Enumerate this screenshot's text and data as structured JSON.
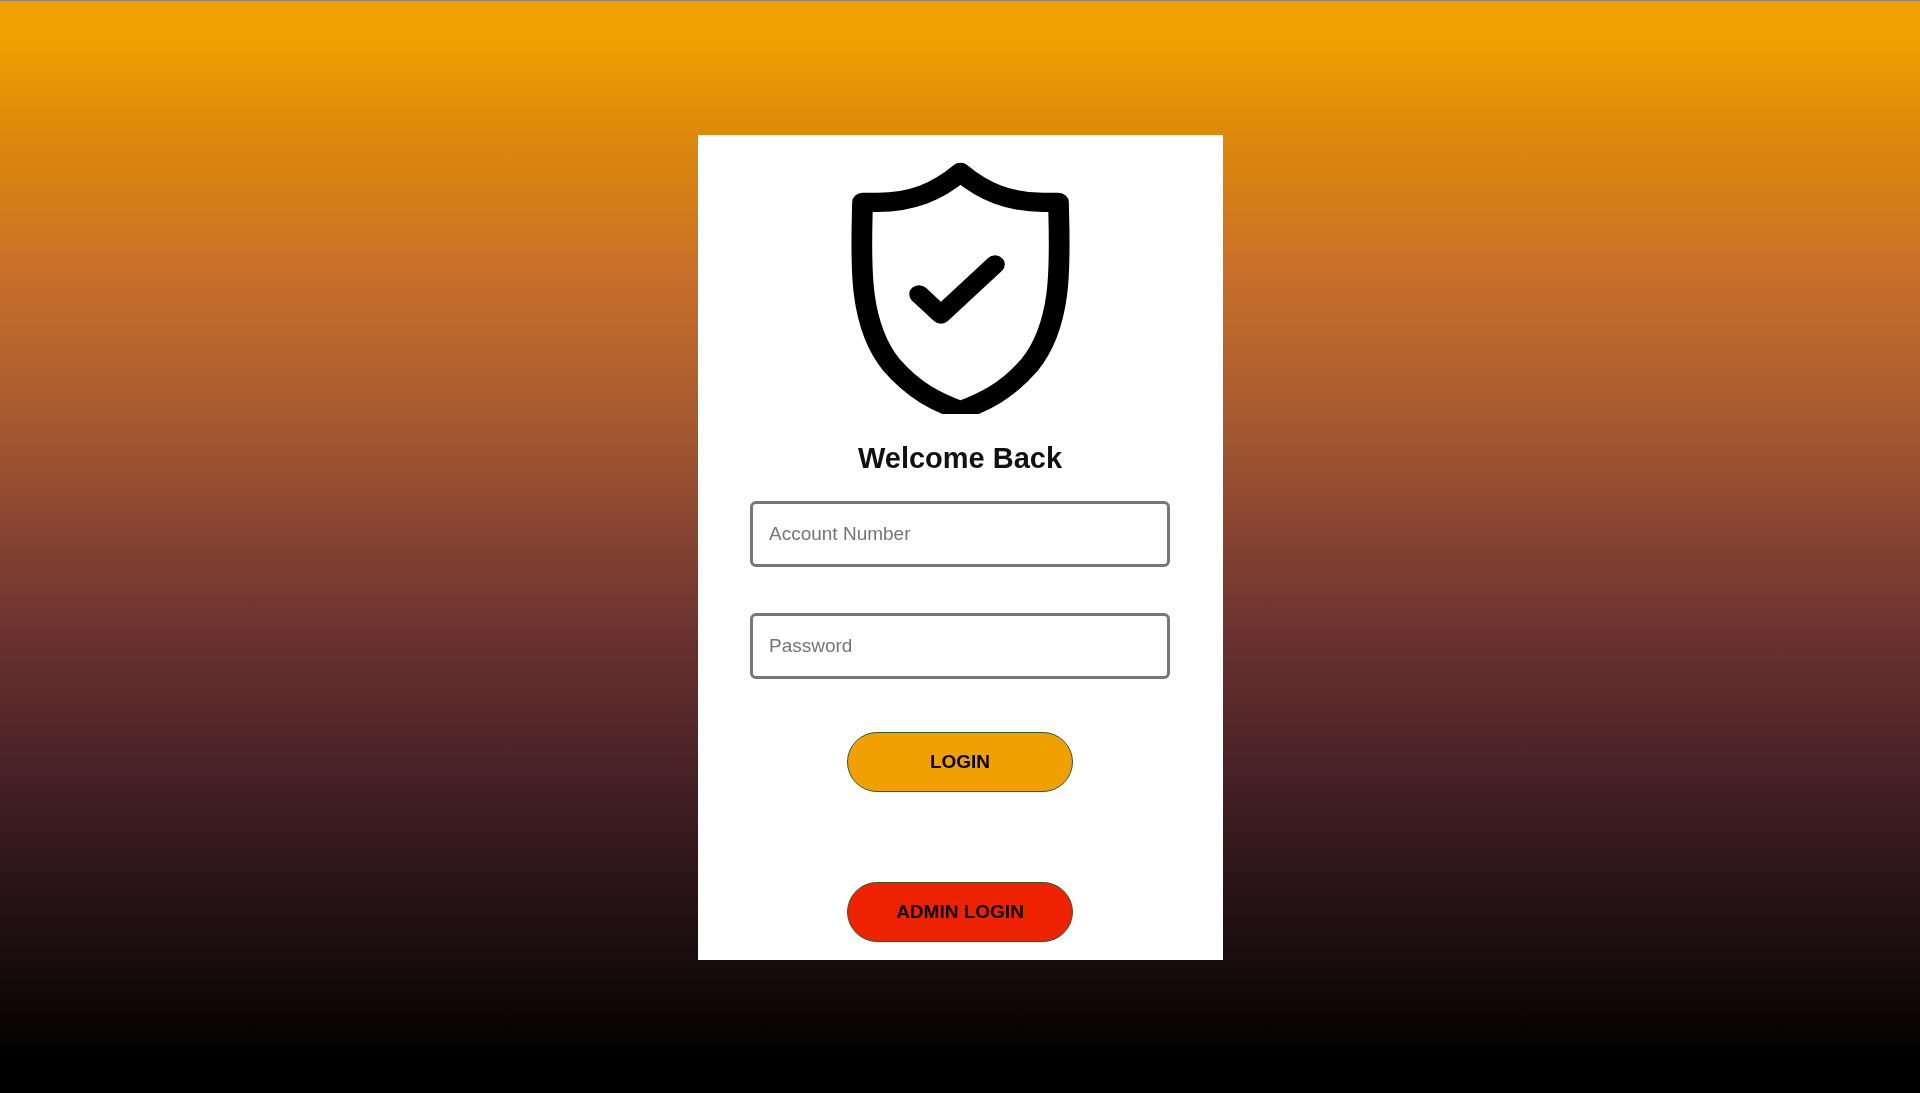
{
  "title": "Welcome Back",
  "fields": [
    {
      "placeholder": "Account Number"
    },
    {
      "placeholder": "Password"
    }
  ],
  "buttons": [
    {
      "label": "LOGIN",
      "kind": "primary"
    },
    {
      "label": "ADMIN LOGIN",
      "kind": "danger"
    }
  ]
}
